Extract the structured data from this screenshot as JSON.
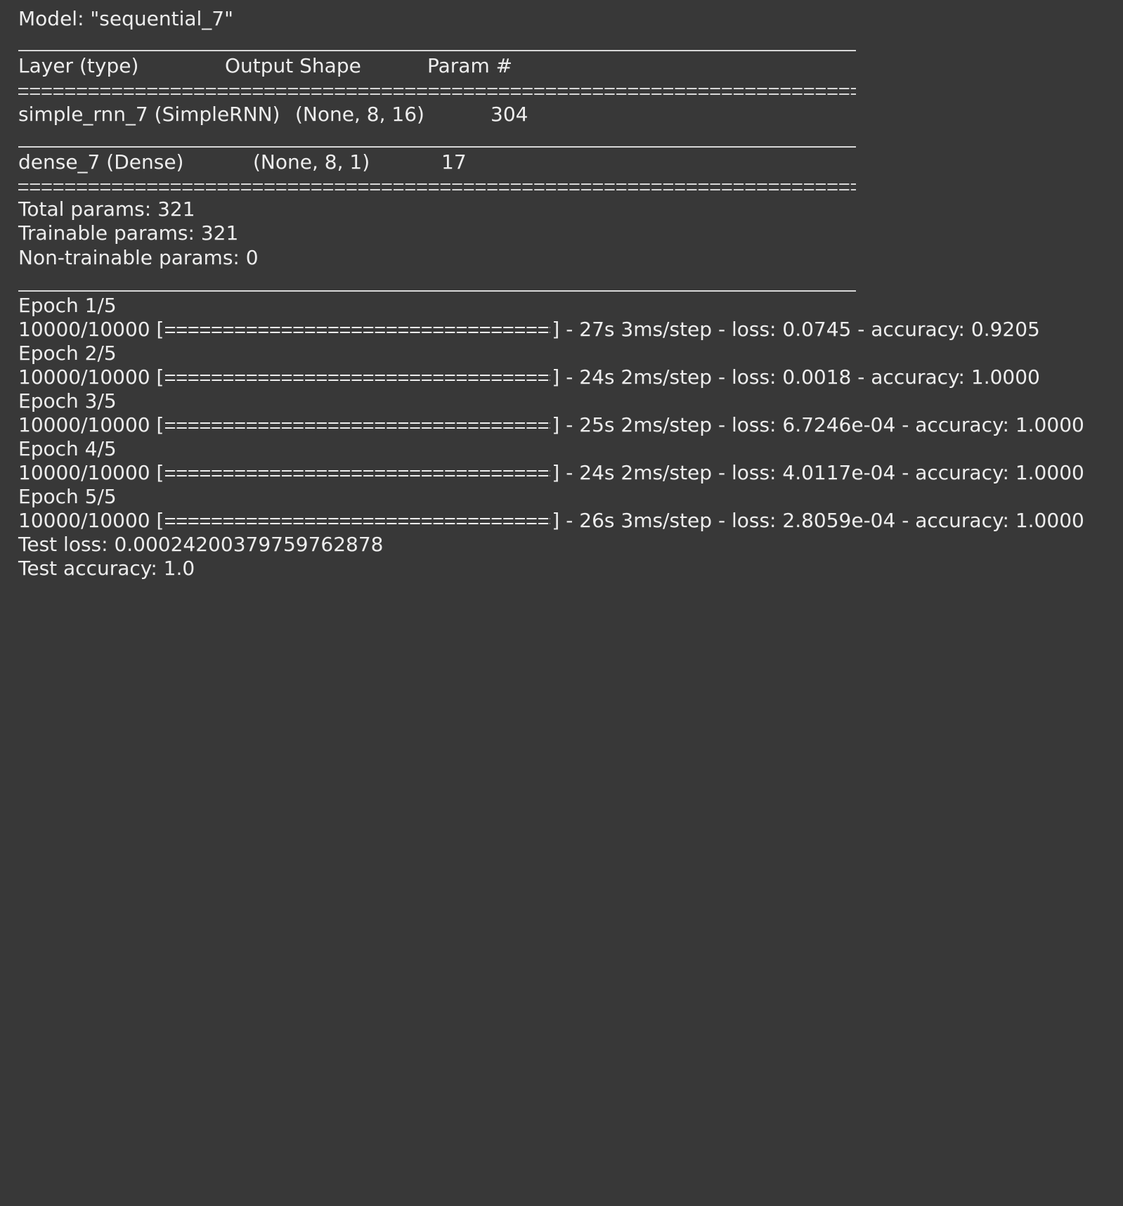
{
  "model_line": "Model: \"sequential_7\"",
  "table": {
    "headers": [
      "Layer (type)",
      "Output Shape",
      "Param #"
    ],
    "rows": [
      {
        "layer": "simple_rnn_7 (SimpleRNN)",
        "shape": "(None, 8, 16)",
        "params": "304"
      },
      {
        "layer": "dense_7 (Dense)",
        "shape": "(None, 8, 1)",
        "params": "17"
      }
    ]
  },
  "summary": {
    "total": "Total params: 321",
    "trainable": "Trainable params: 321",
    "non_trainable": "Non-trainable params: 0"
  },
  "epochs": [
    {
      "label": "Epoch 1/5",
      "progress": "10000/10000",
      "open": "[",
      "close": "]",
      "stats": " - 27s 3ms/step - loss: 0.0745 - accuracy: 0.9205",
      "fill": 1.0
    },
    {
      "label": "Epoch 2/5",
      "progress": "10000/10000",
      "open": "[",
      "close": "]",
      "stats": " - 24s 2ms/step - loss: 0.0018 - accuracy: 1.0000",
      "fill": 1.0
    },
    {
      "label": "Epoch 3/5",
      "progress": "10000/10000",
      "open": "[",
      "close": "]",
      "stats": " - 25s 2ms/step - loss: 6.7246e-04 - accuracy: 1.0000",
      "fill": 1.0
    },
    {
      "label": "Epoch 4/5",
      "progress": "10000/10000",
      "open": "[",
      "close": "]",
      "stats": " - 24s 2ms/step - loss: 4.0117e-04 - accuracy: 1.0000",
      "fill": 1.0
    },
    {
      "label": "Epoch 5/5",
      "progress": "10000/10000",
      "open": "[",
      "close": "]",
      "stats": " - 26s 3ms/step - loss: 2.8059e-04 - accuracy: 1.0000",
      "fill": 1.0
    }
  ],
  "test": {
    "loss": "Test loss: 0.00024200379759762878",
    "accuracy": "Test accuracy: 1.0"
  }
}
